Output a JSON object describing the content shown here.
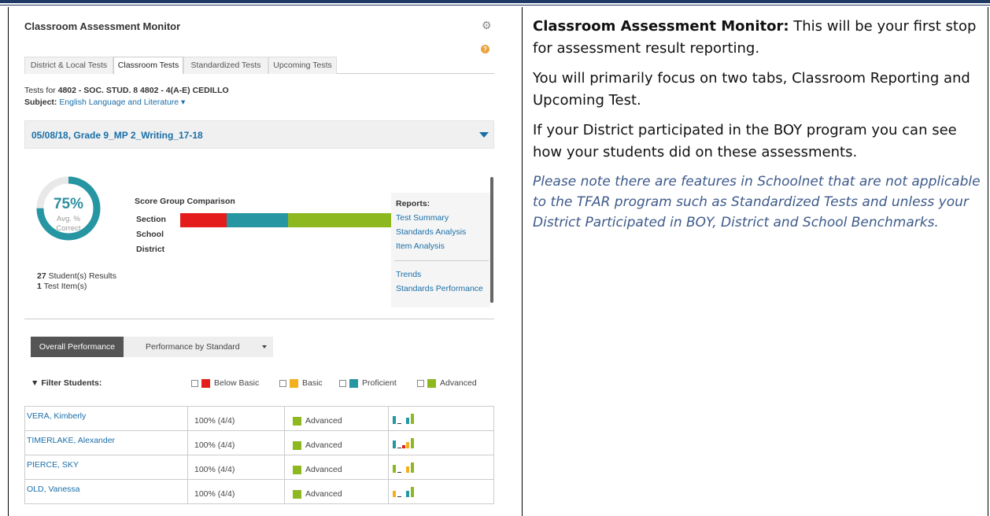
{
  "panel": {
    "title": "Classroom Assessment Monitor",
    "help": "?",
    "tabs": [
      "District & Local Tests",
      "Classroom Tests",
      "Standardized Tests",
      "Upcoming Tests"
    ],
    "active_tab": "Classroom Tests",
    "tests_for_prefix": "Tests for ",
    "tests_for_value": "4802 - SOC. STUD. 8 4802 - 4(A-E) CEDILLO",
    "subject_label": "Subject:",
    "subject_value": "English Language and Literature ▾",
    "test_name": "05/08/18, Grade 9_MP 2_Writing_17-18",
    "avg_pct": "75%",
    "avg_label1": "Avg. %",
    "avg_label2": "Correct",
    "avg_value": 75,
    "students_count": "27",
    "students_text": " Student(s) Results",
    "items_count": "1",
    "items_text": " Test Item(s)",
    "score_group_title": "Score Group Comparison",
    "score_rows": [
      "Section",
      "School",
      "District"
    ],
    "section_bar": [
      {
        "level": "Below Basic",
        "fraction": 0.19,
        "color": "#e41c1c"
      },
      {
        "level": "Proficient",
        "fraction": 0.25,
        "color": "#2596a2"
      },
      {
        "level": "Advanced",
        "fraction": 0.56,
        "color": "#8db820"
      }
    ],
    "reports": {
      "title": "Reports:",
      "links": [
        "Test Summary",
        "Standards Analysis",
        "Item Analysis",
        "Trends",
        "Standards Performance"
      ]
    },
    "perf_tab_active": "Overall Performance",
    "perf_tab_other": "Performance by Standard",
    "filter_label": "Filter Students:",
    "legend": [
      {
        "label": "Below Basic",
        "color": "#e41c1c"
      },
      {
        "label": "Basic",
        "color": "#f2b01e"
      },
      {
        "label": "Proficient",
        "color": "#2596a2"
      },
      {
        "label": "Advanced",
        "color": "#8db820"
      }
    ],
    "students": [
      {
        "name": "VERA, Kimberly",
        "score": "100% (4/4)",
        "level": "Advanced"
      },
      {
        "name": "TIMERLAKE, Alexander",
        "score": "100% (4/4)",
        "level": "Advanced"
      },
      {
        "name": "PIERCE, SKY",
        "score": "100% (4/4)",
        "level": "Advanced"
      },
      {
        "name": "OLD, Vanessa",
        "score": "100% (4/4)",
        "level": "Advanced"
      }
    ]
  },
  "text": {
    "p1_bold": "Classroom Assessment Monitor:",
    "p1_rest": " This will be your first stop for assessment result reporting.",
    "p2": "You will primarily focus on two tabs, Classroom Reporting and Upcoming Test.",
    "p3": "If your District participated in the BOY program you can see how your students did on these assessments.",
    "note": "Please note there are features in Schoolnet that are not applicable to the TFAR program such as Standardized Tests and unless your District Participated in BOY, District and School Benchmarks."
  }
}
